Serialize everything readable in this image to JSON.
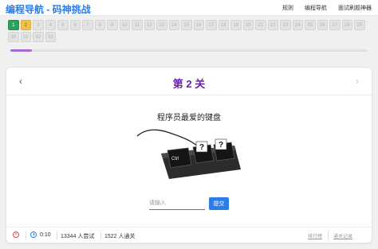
{
  "header": {
    "brand": "编程导航 - 码神挑战",
    "nav": [
      "规则",
      "编程导航",
      "面试刷题神器"
    ]
  },
  "levels": {
    "row1": [
      "1",
      "2",
      "3",
      "4",
      "5",
      "6",
      "7",
      "8",
      "9",
      "10",
      "11",
      "12",
      "13",
      "14",
      "15",
      "16",
      "17",
      "18",
      "19",
      "20",
      "21",
      "22",
      "23",
      "24",
      "25",
      "26",
      "27",
      "28",
      "29"
    ],
    "row2": [
      "30",
      "31",
      "32",
      "33"
    ],
    "done": [
      "1"
    ],
    "current": "2",
    "progress_fraction": 0.06
  },
  "level": {
    "title": "第 2 关",
    "prev_icon": "‹",
    "next_icon": "›",
    "question": "程序员最爱的键盘",
    "keys": [
      "Ctrl",
      "?",
      "?"
    ]
  },
  "answer": {
    "placeholder": "请输入",
    "submit_label": "提交"
  },
  "footer": {
    "timer": "0:10",
    "attempts": "13344 人尝试",
    "passed": "1522 人通关",
    "links": [
      "排行榜",
      "通关记录"
    ]
  },
  "colors": {
    "brand": "#2b7de9",
    "level_title": "#6a1fb0",
    "done": "#29a35a",
    "current": "#f0c24a",
    "progress": "#a26bd6"
  }
}
